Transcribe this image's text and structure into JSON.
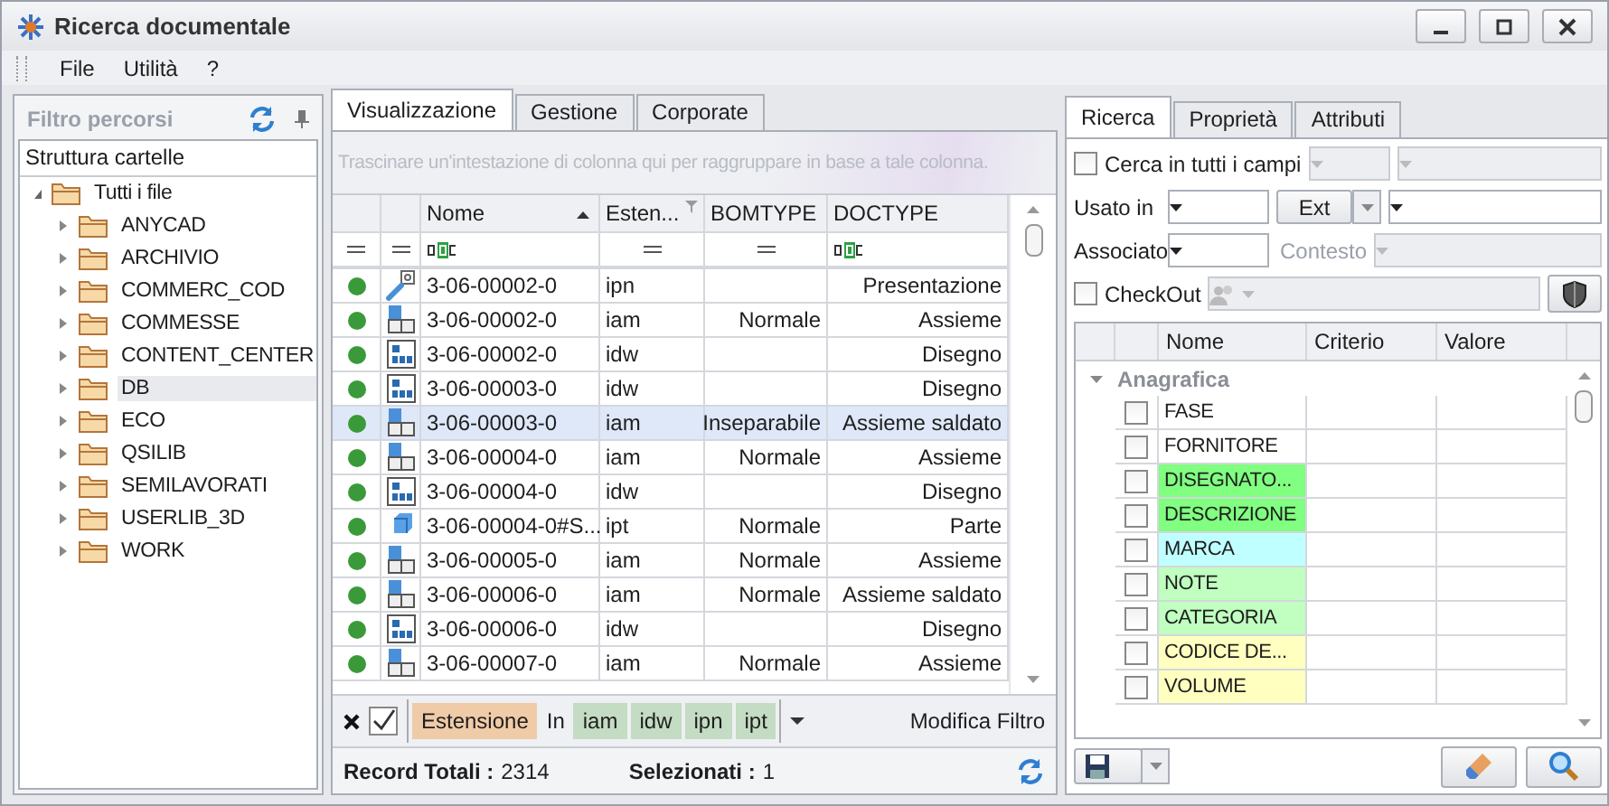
{
  "window": {
    "title": "Ricerca documentale"
  },
  "menu": [
    "File",
    "Utilità",
    "?"
  ],
  "left_panel": {
    "title": "Filtro percorsi",
    "tree_title": "Struttura cartelle",
    "tree": [
      {
        "label": "Tutti i file",
        "expanded": true,
        "selected": false,
        "children": [
          {
            "label": "ANYCAD",
            "expanded": false,
            "selected": false
          },
          {
            "label": "ARCHIVIO",
            "expanded": false,
            "selected": false
          },
          {
            "label": "COMMERC_COD",
            "expanded": false,
            "selected": false
          },
          {
            "label": "COMMESSE",
            "expanded": false,
            "selected": false
          },
          {
            "label": "CONTENT_CENTER",
            "expanded": false,
            "selected": false
          },
          {
            "label": "DB",
            "expanded": false,
            "selected": true
          },
          {
            "label": "ECO",
            "expanded": false,
            "selected": false
          },
          {
            "label": "QSILIB",
            "expanded": false,
            "selected": false
          },
          {
            "label": "SEMILAVORATI",
            "expanded": false,
            "selected": false
          },
          {
            "label": "USERLIB_3D",
            "expanded": false,
            "selected": false
          },
          {
            "label": "WORK",
            "expanded": false,
            "selected": false
          }
        ]
      }
    ]
  },
  "center_tabs": [
    {
      "label": "Visualizzazione",
      "selected": true
    },
    {
      "label": "Gestione",
      "selected": false
    },
    {
      "label": "Corporate",
      "selected": false
    }
  ],
  "grid": {
    "group_hint": "Trascinare un'intestazione di colonna qui per raggruppare in base a tale colonna.",
    "columns": [
      {
        "label": "Nome",
        "sorted": true,
        "filtered": false
      },
      {
        "label": "Esten...",
        "sorted": false,
        "filtered": true
      },
      {
        "label": "BOMTYPE",
        "sorted": false,
        "filtered": false
      },
      {
        "label": "DOCTYPE",
        "sorted": false,
        "filtered": false
      }
    ],
    "rows": [
      {
        "kind": "presentation",
        "nome": "3-06-00002-0",
        "ext": "ipn",
        "bomtype": "",
        "doctype": "Presentazione",
        "selected": false
      },
      {
        "kind": "assembly",
        "nome": "3-06-00002-0",
        "ext": "iam",
        "bomtype": "Normale",
        "doctype": "Assieme",
        "selected": false
      },
      {
        "kind": "drawing",
        "nome": "3-06-00002-0",
        "ext": "idw",
        "bomtype": "",
        "doctype": "Disegno",
        "selected": false
      },
      {
        "kind": "drawing",
        "nome": "3-06-00003-0",
        "ext": "idw",
        "bomtype": "",
        "doctype": "Disegno",
        "selected": false
      },
      {
        "kind": "assembly",
        "nome": "3-06-00003-0",
        "ext": "iam",
        "bomtype": "Inseparabile",
        "doctype": "Assieme saldato",
        "selected": true
      },
      {
        "kind": "assembly",
        "nome": "3-06-00004-0",
        "ext": "iam",
        "bomtype": "Normale",
        "doctype": "Assieme",
        "selected": false
      },
      {
        "kind": "drawing",
        "nome": "3-06-00004-0",
        "ext": "idw",
        "bomtype": "",
        "doctype": "Disegno",
        "selected": false
      },
      {
        "kind": "part",
        "nome": "3-06-00004-0#S...",
        "ext": "ipt",
        "bomtype": "Normale",
        "doctype": "Parte",
        "selected": false
      },
      {
        "kind": "assembly",
        "nome": "3-06-00005-0",
        "ext": "iam",
        "bomtype": "Normale",
        "doctype": "Assieme",
        "selected": false
      },
      {
        "kind": "assembly",
        "nome": "3-06-00006-0",
        "ext": "iam",
        "bomtype": "Normale",
        "doctype": "Assieme saldato",
        "selected": false
      },
      {
        "kind": "drawing",
        "nome": "3-06-00006-0",
        "ext": "idw",
        "bomtype": "",
        "doctype": "Disegno",
        "selected": false
      },
      {
        "kind": "assembly",
        "nome": "3-06-00007-0",
        "ext": "iam",
        "bomtype": "Normale",
        "doctype": "Assieme",
        "selected": false
      }
    ],
    "filter": {
      "enabled": true,
      "field": "Estensione",
      "operator": "In",
      "values": [
        "iam",
        "idw",
        "ipn",
        "ipt"
      ],
      "edit_link": "Modifica Filtro"
    },
    "status": {
      "total_label": "Record Totali :",
      "total": "2314",
      "selected_label": "Selezionati :",
      "selected": "1"
    }
  },
  "right_tabs": [
    {
      "label": "Ricerca",
      "selected": true
    },
    {
      "label": "Proprietà",
      "selected": false
    },
    {
      "label": "Attributi",
      "selected": false
    }
  ],
  "search": {
    "all_fields": {
      "label": "Cerca in tutti i campi",
      "checked": false
    },
    "used_in_label": "Usato in",
    "ext_button": "Ext",
    "associated_label": "Associato",
    "context_label": "Contesto",
    "checkout": {
      "label": "CheckOut",
      "checked": false
    }
  },
  "attributes": {
    "columns": [
      "Nome",
      "Criterio",
      "Valore"
    ],
    "group": "Anagrafica",
    "rows": [
      {
        "name": "FASE",
        "checked": false
      },
      {
        "name": "FORNITORE",
        "checked": false
      },
      {
        "name": "DISEGNATO...",
        "checked": false,
        "color": "#80ff80"
      },
      {
        "name": "DESCRIZIONE",
        "checked": false,
        "color": "#80ff80"
      },
      {
        "name": "MARCA",
        "checked": false,
        "color": "#c0ffff"
      },
      {
        "name": "NOTE",
        "checked": false,
        "color": "#c0ffc0"
      },
      {
        "name": "CATEGORIA",
        "checked": false,
        "color": "#c0ffc0"
      },
      {
        "name": "CODICE DE...",
        "checked": false,
        "color": "#ffffc0"
      },
      {
        "name": "VOLUME",
        "checked": false,
        "color": "#ffffc0"
      }
    ]
  }
}
